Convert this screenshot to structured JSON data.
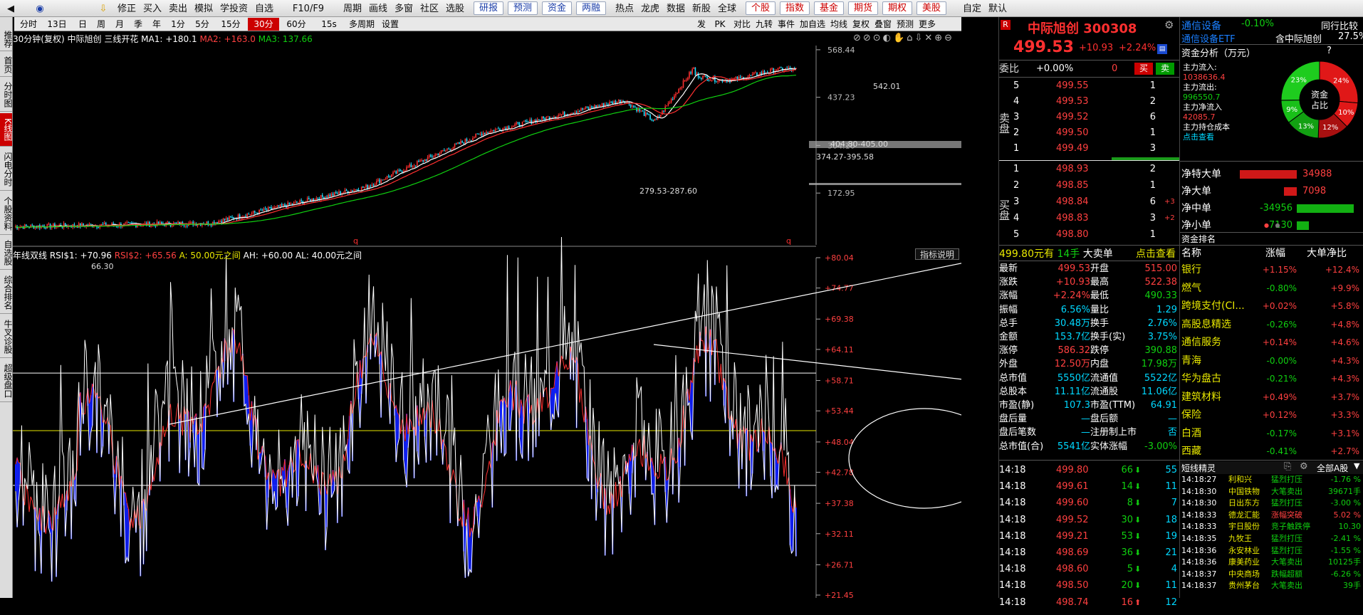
{
  "toolbar": {
    "items": [
      "修正",
      "买入",
      "卖出",
      "模拟",
      "学投资",
      "自选",
      "F10/F9",
      "周期",
      "画线",
      "多窗",
      "社区",
      "选股"
    ],
    "boxed": [
      "研报",
      "预测",
      "资金",
      "两融"
    ],
    "items2": [
      "热点",
      "龙虎",
      "数据",
      "新股",
      "全球"
    ],
    "boxed2": [
      "个股",
      "指数",
      "基金",
      "期货",
      "期权",
      "美股"
    ],
    "items3": [
      "自定",
      "默认"
    ]
  },
  "period": {
    "items": [
      "分时",
      "13日",
      "日",
      "周",
      "月",
      "季",
      "年",
      "1分",
      "5分",
      "15分",
      "30分",
      "60分",
      "15s",
      "多周期",
      "设置"
    ],
    "active": "30分",
    "right_items": [
      "发",
      "PK",
      "对比",
      "九转",
      "事件",
      "加自选",
      "均线",
      "复权",
      "叠窗",
      "预测",
      "更多"
    ]
  },
  "leftnav": [
    "推荐",
    "首页",
    "分时图",
    "K线图",
    "闪电分时",
    "个股资料",
    "自选股",
    "综合排名",
    "牛叉诊股",
    "超级盘口"
  ],
  "leftnav_active": "K线图",
  "kline": {
    "header_prefix": "30分钟(复权)",
    "stock": "中际旭创",
    "pattern": "三线开花",
    "ma1": "MA1: +180.1",
    "ma2": "MA2: +163.0",
    "ma3": "MA3: 137.66",
    "yticks": [
      "568.44",
      "437.23",
      "304.16",
      "172.95"
    ],
    "annotations": [
      "542.01",
      "404.80-405.00",
      "374.27-395.58",
      "279.53-287.60",
      "66.30"
    ],
    "markers": [
      "q",
      "q"
    ]
  },
  "rsi": {
    "header": "年线双线",
    "rsi1": "RSI$1: +70.96",
    "rsi2": "RSI$2: +65.56",
    "a": "A: 50.00元之间",
    "ah": "AH: +60.00",
    "al": "AL: 40.00元之间",
    "explain": "指标说明",
    "yticks": [
      "+80.04",
      "+74.77",
      "+69.38",
      "+64.11",
      "+58.71",
      "+53.44",
      "+48.04",
      "+42.78",
      "+37.38",
      "+32.11",
      "+26.71",
      "+21.45"
    ]
  },
  "quote": {
    "flag": "R",
    "name": "中际旭创 300308",
    "price": "499.53",
    "change": "+10.93",
    "pct": "+2.24%",
    "ratio_label": "委比",
    "ratio": "+0.00%",
    "ratio_diff": "0",
    "buy": "买",
    "sell": "卖",
    "sell_side": "卖盘",
    "buy_side": "买盘",
    "asks": [
      {
        "n": "5",
        "p": "499.55",
        "v": "1"
      },
      {
        "n": "4",
        "p": "499.53",
        "v": "2"
      },
      {
        "n": "3",
        "p": "499.52",
        "v": "6"
      },
      {
        "n": "2",
        "p": "499.50",
        "v": "1"
      },
      {
        "n": "1",
        "p": "499.49",
        "v": "3"
      }
    ],
    "bids": [
      {
        "n": "1",
        "p": "498.93",
        "v": "2",
        "c": ""
      },
      {
        "n": "2",
        "p": "498.85",
        "v": "1",
        "c": ""
      },
      {
        "n": "3",
        "p": "498.84",
        "v": "6",
        "c": "+3"
      },
      {
        "n": "4",
        "p": "498.83",
        "v": "3",
        "c": "+2"
      },
      {
        "n": "5",
        "p": "498.80",
        "v": "1",
        "c": ""
      }
    ],
    "bigorder": {
      "price": "499.80元有",
      "vol": "14手",
      "label": "大卖单",
      "link": "点击查看"
    },
    "stats": [
      [
        "最新",
        "499.53",
        "开盘",
        "515.00"
      ],
      [
        "涨跌",
        "+10.93",
        "最高",
        "522.38"
      ],
      [
        "涨幅",
        "+2.24%",
        "最低",
        "490.33"
      ],
      [
        "振幅",
        "6.56%",
        "量比",
        "1.29"
      ],
      [
        "总手",
        "30.48万",
        "换手",
        "2.76%"
      ],
      [
        "金额",
        "153.7亿",
        "换手(实)",
        "3.75%"
      ],
      [
        "涨停",
        "586.32",
        "跌停",
        "390.88"
      ],
      [
        "外盘",
        "12.50万",
        "内盘",
        "17.98万"
      ],
      [
        "总市值",
        "5550亿",
        "流通值",
        "5522亿"
      ],
      [
        "总股本",
        "11.11亿",
        "流通股",
        "11.06亿"
      ],
      [
        "市盈(静)",
        "107.3",
        "市盈(TTM)",
        "64.91"
      ],
      [
        "盘后量",
        "—",
        "盘后额",
        "—"
      ],
      [
        "盘后笔数",
        "—",
        "注册制上市",
        "否"
      ],
      [
        "总市值(合)",
        "5541亿",
        "实体涨幅",
        "-3.00%"
      ]
    ],
    "ticks": [
      {
        "t": "14:18",
        "p": "499.80",
        "v": "66",
        "d": "down",
        "n": "55"
      },
      {
        "t": "14:18",
        "p": "499.61",
        "v": "14",
        "d": "down",
        "n": "11"
      },
      {
        "t": "14:18",
        "p": "499.60",
        "v": "8",
        "d": "down",
        "n": "7"
      },
      {
        "t": "14:18",
        "p": "499.52",
        "v": "30",
        "d": "down",
        "n": "18"
      },
      {
        "t": "14:18",
        "p": "499.21",
        "v": "53",
        "d": "down",
        "n": "19"
      },
      {
        "t": "14:18",
        "p": "498.69",
        "v": "36",
        "d": "down",
        "n": "21"
      },
      {
        "t": "14:18",
        "p": "498.60",
        "v": "5",
        "d": "down",
        "n": "4"
      },
      {
        "t": "14:18",
        "p": "498.50",
        "v": "20",
        "d": "down",
        "n": "11"
      },
      {
        "t": "14:18",
        "p": "498.74",
        "v": "16",
        "d": "up",
        "n": "12"
      }
    ]
  },
  "right": {
    "sector": "通信设备",
    "sector_pct": "-0.10%",
    "peer_label": "同行比较",
    "etf": "通信设备ETF",
    "contains": "含中际旭创",
    "etf_pct": "27.5%",
    "fund_title": "资金分析（万元）",
    "help": "?",
    "inflow_label": "主力流入:",
    "inflow": "1038636.4",
    "outflow_label": "主力流出:",
    "outflow": "996550.7",
    "net_label": "主力净流入",
    "net": "42085.7",
    "cost_label": "主力持仓成本",
    "cost_link": "点击查看",
    "donut_center1": "资金",
    "donut_center2": "占比",
    "donut_labels": [
      "23%",
      "24%",
      "9%",
      "10%",
      "13%",
      "12%"
    ],
    "flows": [
      {
        "label": "净特大单",
        "value": "34988",
        "sign": "pos",
        "ratio": 0.8
      },
      {
        "label": "净大单",
        "value": "7098",
        "sign": "pos",
        "ratio": 0.18
      },
      {
        "label": "净中单",
        "value": "-34956",
        "sign": "neg",
        "ratio": 0.8
      },
      {
        "label": "净小单",
        "value": "-7130",
        "sign": "neg",
        "ratio": 0.17
      }
    ],
    "rank_title": "资金排名",
    "rank_headers": [
      "名称",
      "涨幅",
      "大单净比"
    ],
    "rank": [
      [
        "银行",
        "+1.15%",
        "+12.4%"
      ],
      [
        "燃气",
        "-0.80%",
        "+9.9%"
      ],
      [
        "跨境支付(CI...",
        "+0.02%",
        "+5.8%"
      ],
      [
        "高股息精选",
        "-0.26%",
        "+4.8%"
      ],
      [
        "通信服务",
        "+0.14%",
        "+4.6%"
      ],
      [
        "青海",
        "-0.00%",
        "+4.3%"
      ],
      [
        "华为盘古",
        "-0.21%",
        "+4.3%"
      ],
      [
        "建筑材料",
        "+0.49%",
        "+3.7%"
      ],
      [
        "保险",
        "+0.12%",
        "+3.3%"
      ],
      [
        "白酒",
        "-0.17%",
        "+3.1%"
      ],
      [
        "西藏",
        "-0.41%",
        "+2.7%"
      ]
    ],
    "short_title": "短线精灵",
    "short_filter": "全部A股",
    "short": [
      [
        "14:18:27",
        "利和兴",
        "猛烈打压",
        "-1.76 %"
      ],
      [
        "14:18:30",
        "中国铁物",
        "大笔卖出",
        "39671手"
      ],
      [
        "14:18:30",
        "日出东方",
        "猛烈打压",
        "-3.00 %"
      ],
      [
        "14:18:33",
        "德龙汇能",
        "涨幅突破",
        "5.02 %"
      ],
      [
        "14:18:33",
        "宇日股份",
        "竞子触跌停",
        "10.30"
      ],
      [
        "14:18:35",
        "九牧王",
        "猛烈打压",
        "-2.41 %"
      ],
      [
        "14:18:36",
        "永安林业",
        "猛烈打压",
        "-1.55 %"
      ],
      [
        "14:18:36",
        "康美药业",
        "大笔卖出",
        "10125手"
      ],
      [
        "14:18:37",
        "中央商场",
        "跌幅超额",
        "-6.26 %"
      ],
      [
        "14:18:37",
        "贵州茅台",
        "大笔卖出",
        "39手"
      ]
    ]
  }
}
